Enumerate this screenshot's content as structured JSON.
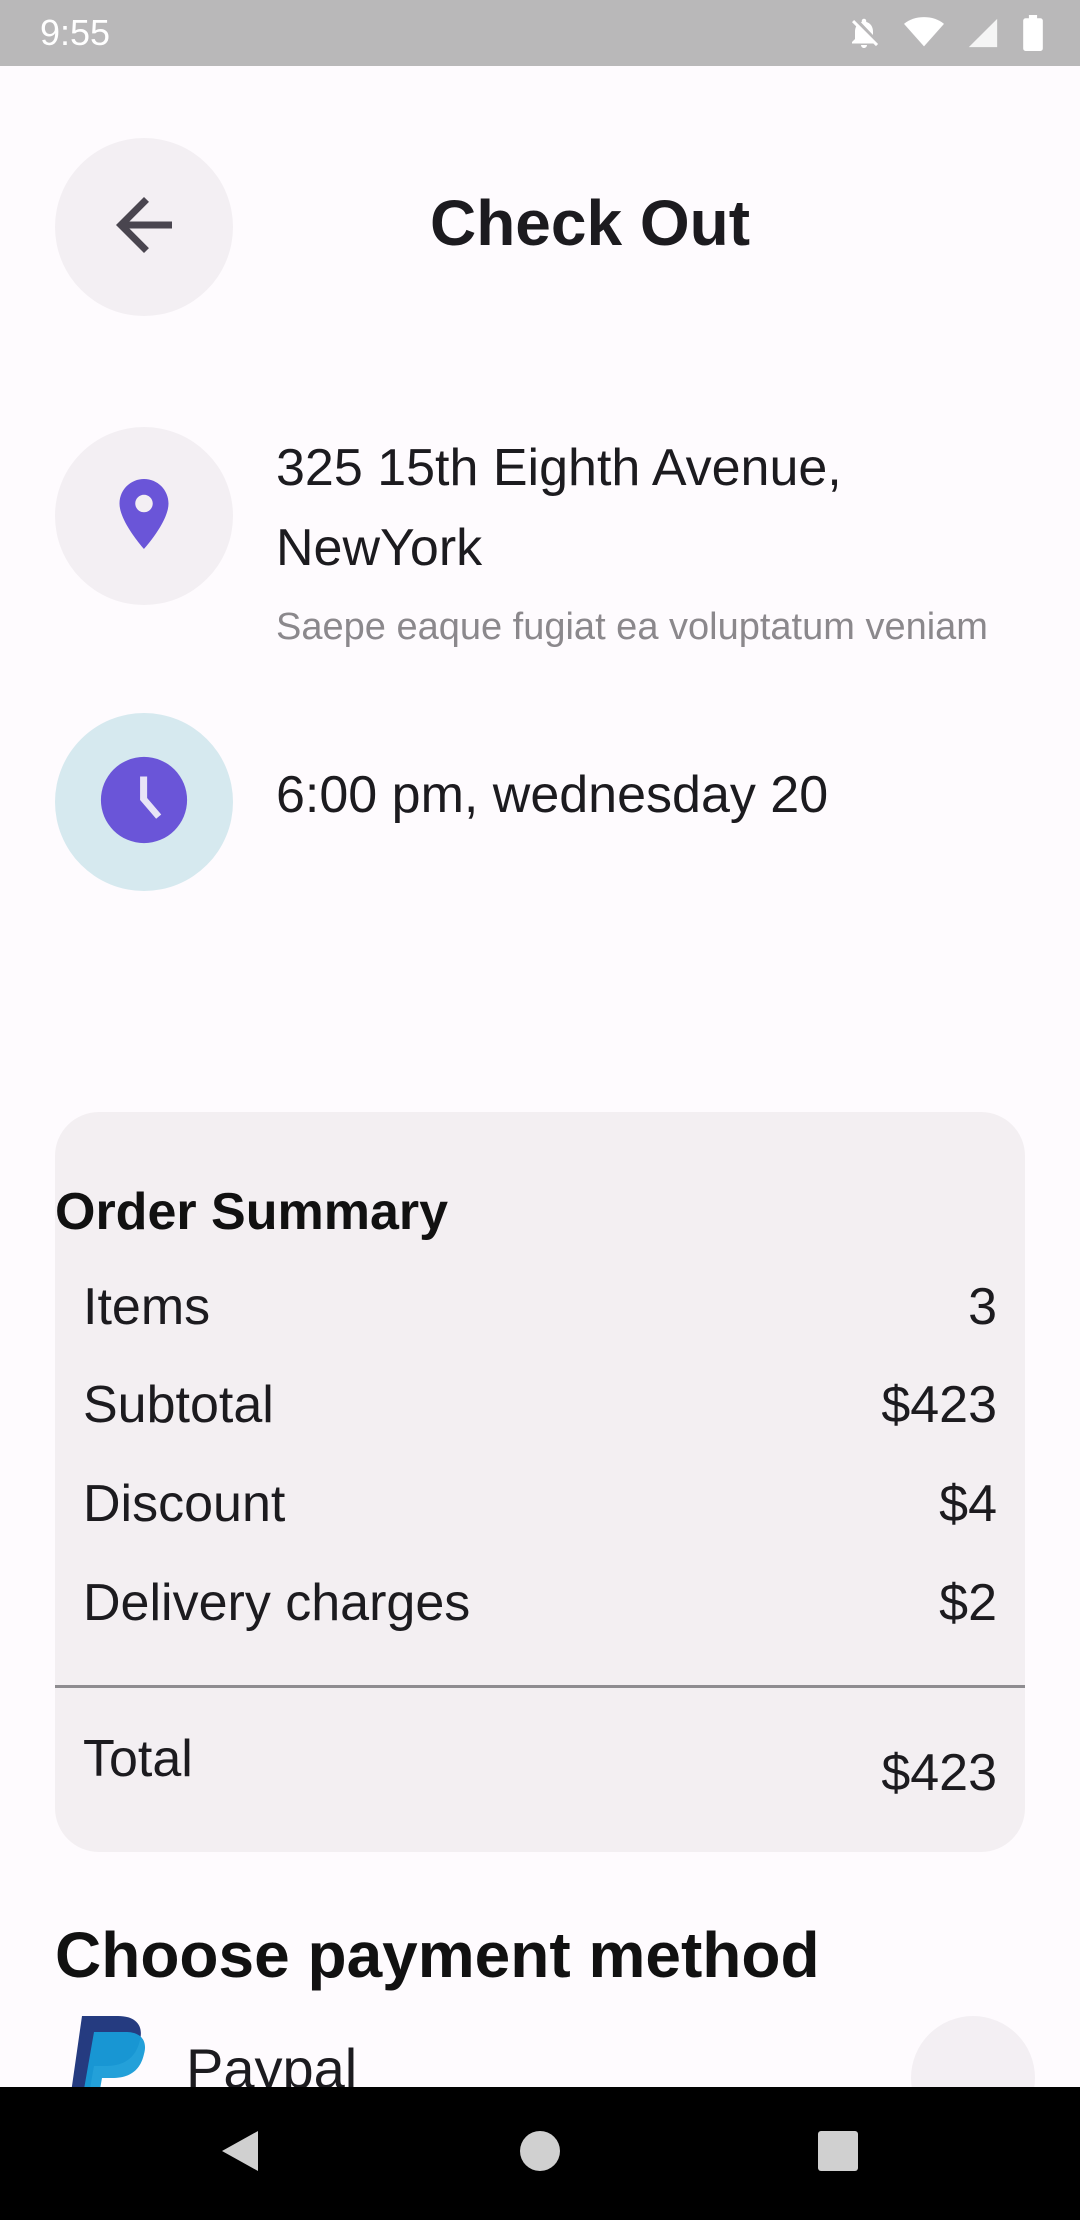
{
  "status_bar": {
    "time": "9:55",
    "icons": [
      "notifications-off-icon",
      "wifi-icon",
      "signal-icon",
      "battery-icon"
    ]
  },
  "header": {
    "title": "Check Out",
    "back_icon": "arrow-back-icon"
  },
  "delivery": {
    "address": "325 15th Eighth Avenue, NewYork",
    "address_detail": "Saepe eaque fugiat ea voluptatum veniam",
    "time": "6:00 pm, wednesday 20",
    "location_icon": "location-pin-icon",
    "time_icon": "clock-icon"
  },
  "order_summary": {
    "title": "Order Summary",
    "rows": [
      {
        "label": "Items",
        "value": "3"
      },
      {
        "label": "Subtotal",
        "value": "$423"
      },
      {
        "label": "Discount",
        "value": "$4"
      },
      {
        "label": "Delivery charges",
        "value": "$2"
      }
    ],
    "total_label": "Total",
    "total_value": "$423"
  },
  "payment": {
    "title": "Choose payment method",
    "methods": [
      {
        "label": "Paypal",
        "icon": "paypal-icon"
      }
    ]
  },
  "colors": {
    "accent": "#6a55d8",
    "background": "#fefbfe",
    "card": "#f3eff2",
    "clock_bg": "#d6e9ef"
  }
}
